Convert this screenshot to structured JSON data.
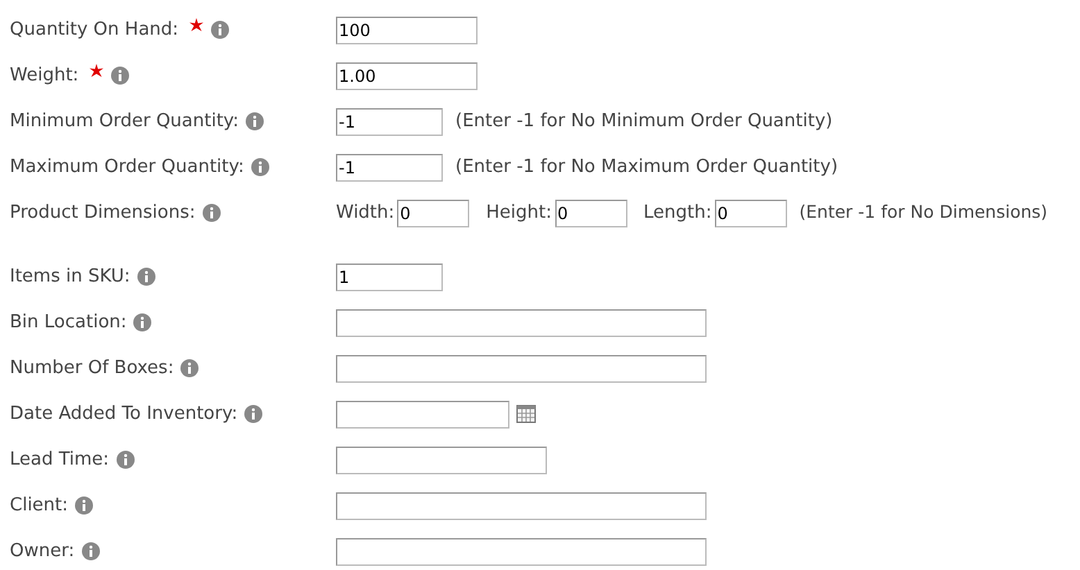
{
  "sections": [
    {
      "rows": [
        {
          "label": "Quantity On Hand:",
          "required": true,
          "kind": "number",
          "value": "100"
        },
        {
          "label": "Weight:",
          "required": true,
          "kind": "number",
          "value": "1.00"
        },
        {
          "label": "Minimum Order Quantity:",
          "required": false,
          "kind": "small",
          "value": "-1",
          "note": "(Enter -1 for No Minimum Order Quantity)"
        },
        {
          "label": "Maximum Order Quantity:",
          "required": false,
          "kind": "small",
          "value": "-1",
          "note": "(Enter -1 for No Maximum Order Quantity)"
        },
        {
          "label": "Product Dimensions:",
          "required": false,
          "kind": "dimensions",
          "parts": [
            {
              "label": "Width:",
              "value": "0"
            },
            {
              "label": "Height:",
              "value": "0"
            },
            {
              "label": "Length:",
              "value": "0"
            }
          ],
          "note": "(Enter -1 for No Dimensions)"
        }
      ]
    },
    {
      "rows": [
        {
          "label": "Items in SKU:",
          "required": false,
          "kind": "small",
          "value": "1"
        },
        {
          "label": "Bin Location:",
          "required": false,
          "kind": "text"
        },
        {
          "label": "Number Of Boxes:",
          "required": false,
          "kind": "text"
        },
        {
          "label": "Date Added To Inventory:",
          "required": false,
          "kind": "date"
        },
        {
          "label": "Lead Time:",
          "required": false,
          "kind": "medium"
        },
        {
          "label": "Client:",
          "required": false,
          "kind": "text"
        },
        {
          "label": "Owner:",
          "required": false,
          "kind": "text"
        }
      ]
    }
  ]
}
